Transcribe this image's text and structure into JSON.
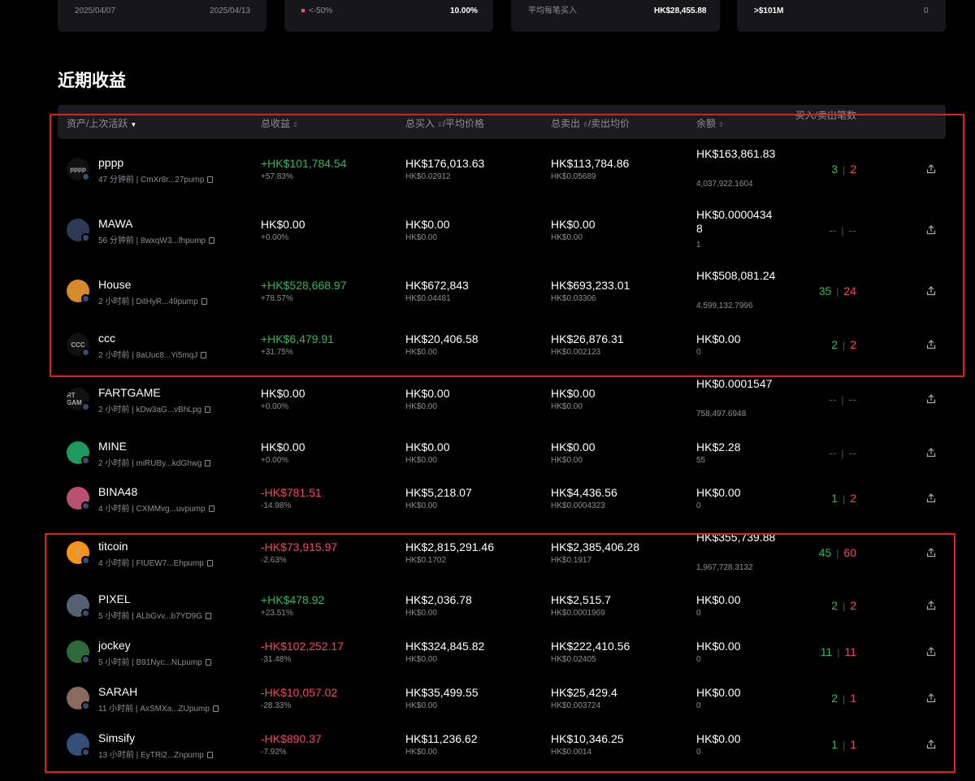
{
  "top_cards": {
    "c1_left": "2025/04/07",
    "c1_right": "2025/04/13",
    "c2_left": "<-50%",
    "c2_right": "10.00%",
    "c3_left": "平均每笔买入",
    "c3_right": "HK$28,455.88",
    "c4_left": ">$101M",
    "c4_right": "0"
  },
  "section_title": "近期收益",
  "headers": {
    "asset": "资产/上次活跃",
    "pnl": "总收益",
    "bought": "总买入",
    "bought_suffix": "/平均价格",
    "sold": "总卖出",
    "sold_suffix": "/卖出均价",
    "balance": "余额",
    "trades": "买入/卖出笔数"
  },
  "colors": {
    "positive": "#2fb65b",
    "negative": "#f0485c",
    "highlight_box": "#e0201c"
  },
  "rows": [
    {
      "name": "pppp",
      "sub": "47 分钟前 | CmXr8r...27pump",
      "pnl": "+HK$101,784.54",
      "pnl_pct": "+57.83%",
      "pnl_dir": "pos",
      "bought": "HK$176,013.63",
      "bought_avg": "HK$0.02912",
      "sold": "HK$113,784.86",
      "sold_avg": "HK$0.05689",
      "balance": "HK$163,861.83",
      "balance_sub": "4,037,922.1604",
      "buys": "3",
      "sells": "2",
      "avatar_text": "pppp",
      "avatar_color": "#111"
    },
    {
      "name": "MAWA",
      "sub": "56 分钟前 | 8wxqW3...fhpump",
      "pnl": "HK$0.00",
      "pnl_pct": "+0.00%",
      "pnl_dir": "zero",
      "bought": "HK$0.00",
      "bought_avg": "HK$0.00",
      "sold": "HK$0.00",
      "sold_avg": "HK$0.00",
      "balance": "HK$0.00004348",
      "balance_sub": "1",
      "buys": "--",
      "sells": "--",
      "avatar_text": "",
      "avatar_color": "#2c3a55"
    },
    {
      "name": "House",
      "sub": "2 小时前 | DitHyR...49pump",
      "pnl": "+HK$528,668.97",
      "pnl_pct": "+78.57%",
      "pnl_dir": "pos",
      "bought": "HK$672,843",
      "bought_avg": "HK$0.04481",
      "sold": "HK$693,233.01",
      "sold_avg": "HK$0.03306",
      "balance": "HK$508,081.24",
      "balance_sub": "4,599,132.7996",
      "buys": "35",
      "sells": "24",
      "avatar_text": "",
      "avatar_color": "#d98a2b"
    },
    {
      "name": "ccc",
      "sub": "2 小时前 | 8aUuc8...Yi5mqJ",
      "pnl": "+HK$6,479.91",
      "pnl_pct": "+31.75%",
      "pnl_dir": "pos",
      "bought": "HK$20,406.58",
      "bought_avg": "HK$0.00",
      "sold": "HK$26,876.31",
      "sold_avg": "HK$0.002123",
      "balance": "HK$0.00",
      "balance_sub": "0",
      "buys": "2",
      "sells": "2",
      "avatar_text": "CCC",
      "avatar_color": "#111"
    },
    {
      "name": "FARTGAME",
      "sub": "2 小时前 | kDw3aG...vBhLpg",
      "pnl": "HK$0.00",
      "pnl_pct": "+0.00%",
      "pnl_dir": "zero",
      "bought": "HK$0.00",
      "bought_avg": "HK$0.00",
      "sold": "HK$0.00",
      "sold_avg": "HK$0.00",
      "balance": "HK$0.0001547",
      "balance_sub": "758,497.6948",
      "buys": "--",
      "sells": "--",
      "avatar_text": "RT GAM",
      "avatar_color": "#111"
    },
    {
      "name": "MINE",
      "sub": "2 小时前 | miRUBy...kdGhwg",
      "pnl": "HK$0.00",
      "pnl_pct": "+0.00%",
      "pnl_dir": "zero",
      "bought": "HK$0.00",
      "bought_avg": "HK$0.00",
      "sold": "HK$0.00",
      "sold_avg": "HK$0.00",
      "balance": "HK$2.28",
      "balance_sub": "55",
      "buys": "--",
      "sells": "--",
      "avatar_text": "",
      "avatar_color": "#1f9a5a"
    },
    {
      "name": "BINA48",
      "sub": "4 小时前 | CXMMvg...uvpump",
      "pnl": "-HK$781.51",
      "pnl_pct": "-14.98%",
      "pnl_dir": "neg",
      "bought": "HK$5,218.07",
      "bought_avg": "HK$0.00",
      "sold": "HK$4,436.56",
      "sold_avg": "HK$0.0004323",
      "balance": "HK$0.00",
      "balance_sub": "0",
      "buys": "1",
      "sells": "2",
      "avatar_text": "",
      "avatar_color": "#b85070"
    },
    {
      "name": "titcoin",
      "sub": "4 小时前 | FtUEW7...Ehpump",
      "pnl": "-HK$73,915.97",
      "pnl_pct": "-2.63%",
      "pnl_dir": "neg",
      "bought": "HK$2,815,291.46",
      "bought_avg": "HK$0.1702",
      "sold": "HK$2,385,406.28",
      "sold_avg": "HK$0.1917",
      "balance": "HK$355,739.88",
      "balance_sub": "1,967,728.3132",
      "buys": "45",
      "sells": "60",
      "avatar_text": "₿",
      "avatar_color": "#f7931a"
    },
    {
      "name": "PIXEL",
      "sub": "5 小时前 | ALbGvv...b7YD9G",
      "pnl": "+HK$478.92",
      "pnl_pct": "+23.51%",
      "pnl_dir": "pos",
      "bought": "HK$2,036.78",
      "bought_avg": "HK$0.00",
      "sold": "HK$2,515.7",
      "sold_avg": "HK$0.0001969",
      "balance": "HK$0.00",
      "balance_sub": "0",
      "buys": "2",
      "sells": "2",
      "avatar_text": "",
      "avatar_color": "#556070"
    },
    {
      "name": "jockey",
      "sub": "5 小时前 | B91Nyc...NLpump",
      "pnl": "-HK$102,252.17",
      "pnl_pct": "-31.48%",
      "pnl_dir": "neg",
      "bought": "HK$324,845.82",
      "bought_avg": "HK$0.00",
      "sold": "HK$222,410.56",
      "sold_avg": "HK$0.02405",
      "balance": "HK$0.00",
      "balance_sub": "0",
      "buys": "11",
      "sells": "11",
      "avatar_text": "",
      "avatar_color": "#2f6a3a"
    },
    {
      "name": "SARAH",
      "sub": "11 小时前 | AxSMXa...ZUpump",
      "pnl": "-HK$10,057.02",
      "pnl_pct": "-28.33%",
      "pnl_dir": "neg",
      "bought": "HK$35,499.55",
      "bought_avg": "HK$0.00",
      "sold": "HK$25,429.4",
      "sold_avg": "HK$0.003724",
      "balance": "HK$0.00",
      "balance_sub": "0",
      "buys": "2",
      "sells": "1",
      "avatar_text": "",
      "avatar_color": "#8a6a5a"
    },
    {
      "name": "Simsify",
      "sub": "13 小时前 | EyTRi2...Znpump",
      "pnl": "-HK$890.37",
      "pnl_pct": "-7.92%",
      "pnl_dir": "neg",
      "bought": "HK$11,236.62",
      "bought_avg": "HK$0.00",
      "sold": "HK$10,346.25",
      "sold_avg": "HK$0.0014",
      "balance": "HK$0.00",
      "balance_sub": "0",
      "buys": "1",
      "sells": "1",
      "avatar_text": "",
      "avatar_color": "#34507a"
    }
  ]
}
